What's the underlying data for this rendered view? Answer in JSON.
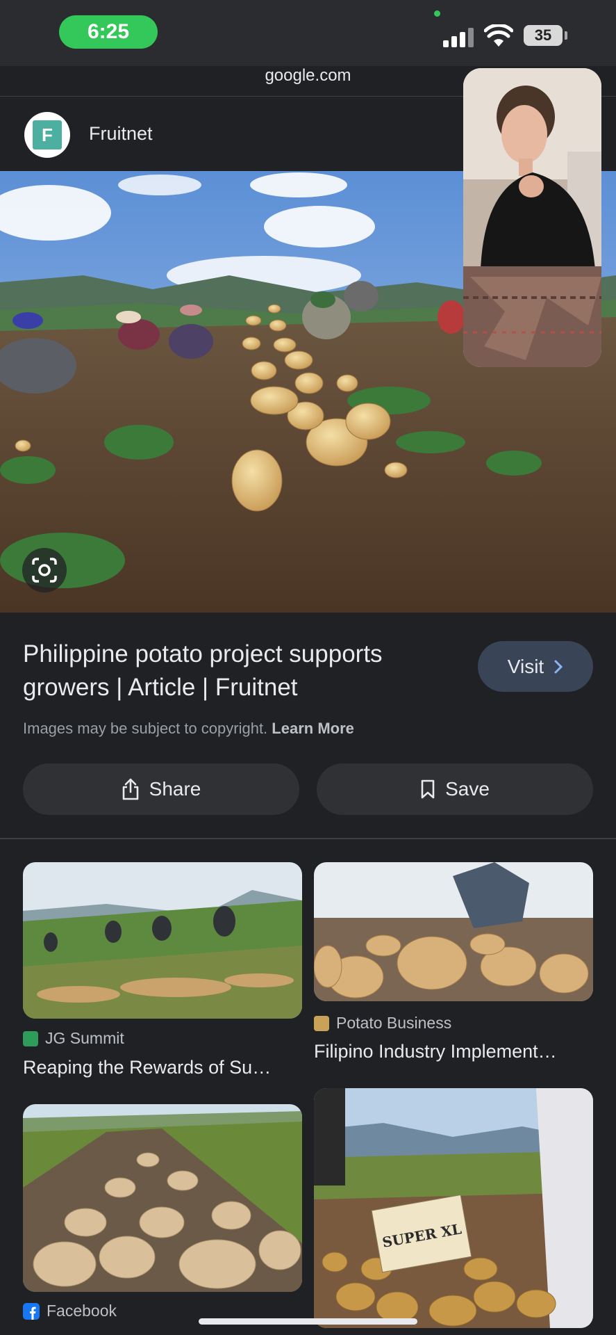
{
  "status_bar": {
    "time": "6:25",
    "battery": "35"
  },
  "browser": {
    "url": "google.com"
  },
  "source": {
    "name": "Fruitnet",
    "logo_letter": "F"
  },
  "result": {
    "title": "Philippine potato project supports growers | Article | Fruitnet",
    "visit_label": "Visit",
    "copyright_text": "Images may be subject to copyright.",
    "learn_more_label": "Learn More",
    "share_label": "Share",
    "save_label": "Save"
  },
  "related": [
    {
      "source": "JG Summit",
      "title": "Reaping the Rewards of Su…",
      "favicon_color": "#2e9d5a"
    },
    {
      "source": "Potato Business",
      "title": "Filipino Industry Implement…",
      "favicon_color": "#c9a25a"
    },
    {
      "source": "Facebook",
      "title": "",
      "favicon_color": "#1877f2"
    },
    {
      "source": "",
      "title": "",
      "sign_text": "SUPER XL"
    }
  ],
  "icons": [
    "signal-icon",
    "wifi-icon",
    "battery-icon",
    "lens-icon",
    "chevron-right-icon",
    "share-icon",
    "bookmark-icon",
    "facebook-icon"
  ]
}
